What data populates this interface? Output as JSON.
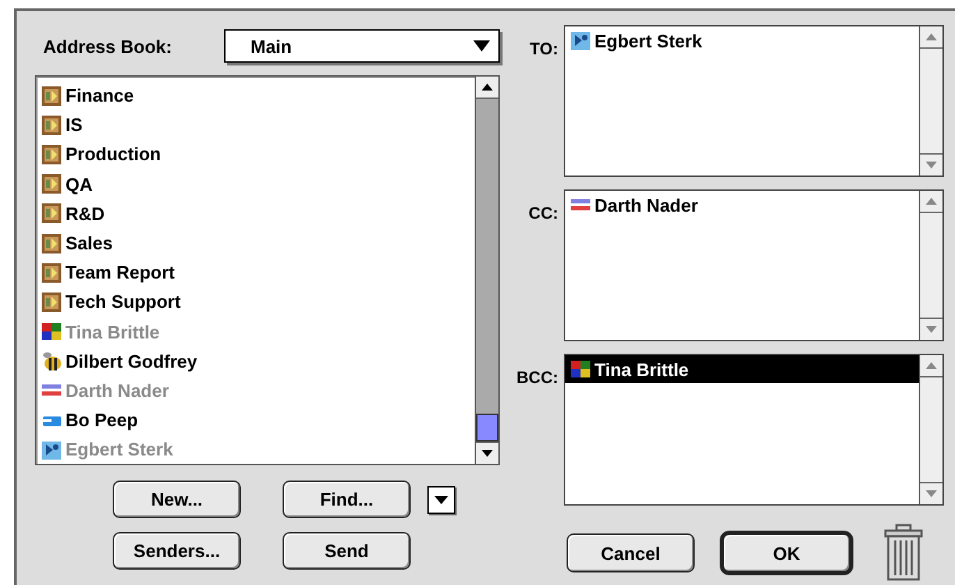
{
  "address_book": {
    "label": "Address Book:",
    "value": "Main"
  },
  "entries": [
    {
      "name": "Finance",
      "kind": "group",
      "dimmed": false
    },
    {
      "name": "IS",
      "kind": "group",
      "dimmed": false
    },
    {
      "name": "Production",
      "kind": "group",
      "dimmed": false
    },
    {
      "name": "QA",
      "kind": "group",
      "dimmed": false
    },
    {
      "name": "R&D",
      "kind": "group",
      "dimmed": false
    },
    {
      "name": "Sales",
      "kind": "group",
      "dimmed": false
    },
    {
      "name": "Team Report",
      "kind": "group",
      "dimmed": false
    },
    {
      "name": "Tech Support",
      "kind": "group",
      "dimmed": false
    },
    {
      "name": "Tina Brittle",
      "kind": "person",
      "dimmed": true
    },
    {
      "name": "Dilbert Godfrey",
      "kind": "person",
      "dimmed": false
    },
    {
      "name": "Darth Nader",
      "kind": "person",
      "dimmed": true
    },
    {
      "name": "Bo Peep",
      "kind": "person",
      "dimmed": false
    },
    {
      "name": "Egbert Sterk",
      "kind": "person",
      "dimmed": true
    }
  ],
  "left_buttons": [
    "New...",
    "Find...",
    "Senders...",
    "Send"
  ],
  "fields": [
    {
      "label": "TO:",
      "recipients": [
        {
          "name": "Egbert Sterk",
          "selected": false
        }
      ]
    },
    {
      "label": "CC:",
      "recipients": [
        {
          "name": "Darth Nader",
          "selected": false
        }
      ]
    },
    {
      "label": "BCC:",
      "recipients": [
        {
          "name": "Tina Brittle",
          "selected": true
        }
      ]
    }
  ],
  "dialog_buttons": [
    "Cancel",
    "OK"
  ]
}
